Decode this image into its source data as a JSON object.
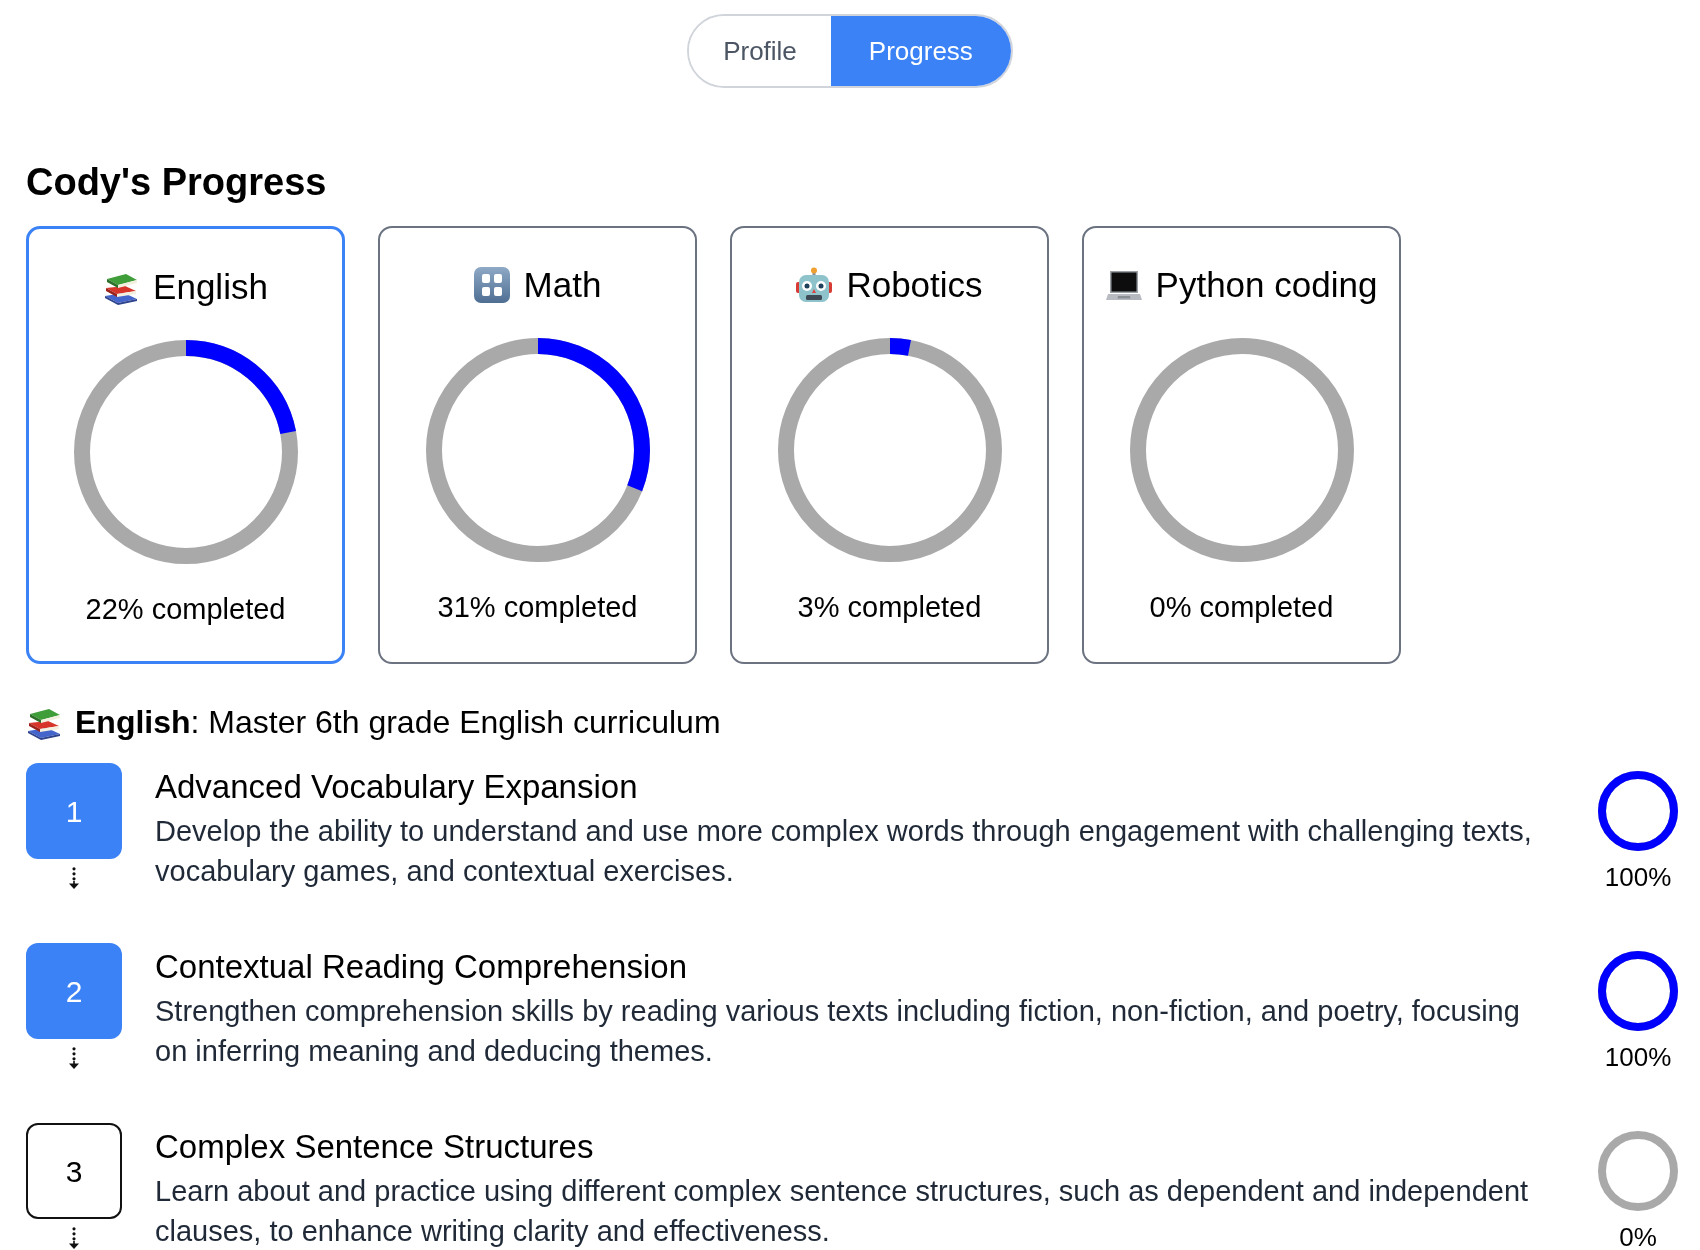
{
  "tabs": [
    {
      "label": "Profile",
      "selected": false
    },
    {
      "label": "Progress",
      "selected": true
    }
  ],
  "title": "Cody's Progress",
  "subjects": [
    {
      "name": "English",
      "level": 0.22,
      "caption": "22% completed",
      "selected": true
    },
    {
      "name": "Math",
      "level": 0.31,
      "caption": "31% completed",
      "selected": false
    },
    {
      "name": "Robotics",
      "level": 0.03,
      "caption": "3% completed",
      "selected": false
    },
    {
      "name": "Python coding",
      "level": 0,
      "caption": "0% completed",
      "selected": false
    }
  ],
  "detail": {
    "heading": "**English**: Master 6th grade English curriculum",
    "steps": [
      {
        "number": "1",
        "title": "Advanced Vocabulary Expansion",
        "description": "Develop the ability to understand and use more complex words through engagement with challenging texts, vocabulary games, and contextual exercises.",
        "completed": true,
        "level": 1,
        "reading": "100%"
      },
      {
        "number": "2",
        "title": "Contextual Reading Comprehension",
        "description": "Strengthen comprehension skills by reading various texts including fiction, non-fiction, and poetry, focusing on inferring meaning and deducing themes.",
        "completed": true,
        "level": 1,
        "reading": "100%"
      },
      {
        "number": "3",
        "title": "Complex Sentence Structures",
        "description": "Learn about and practice using different complex sentence structures, such as dependent and independent clauses, to enhance writing clarity and effectiveness.",
        "completed": false,
        "level": 0,
        "reading": "0%"
      }
    ]
  }
}
